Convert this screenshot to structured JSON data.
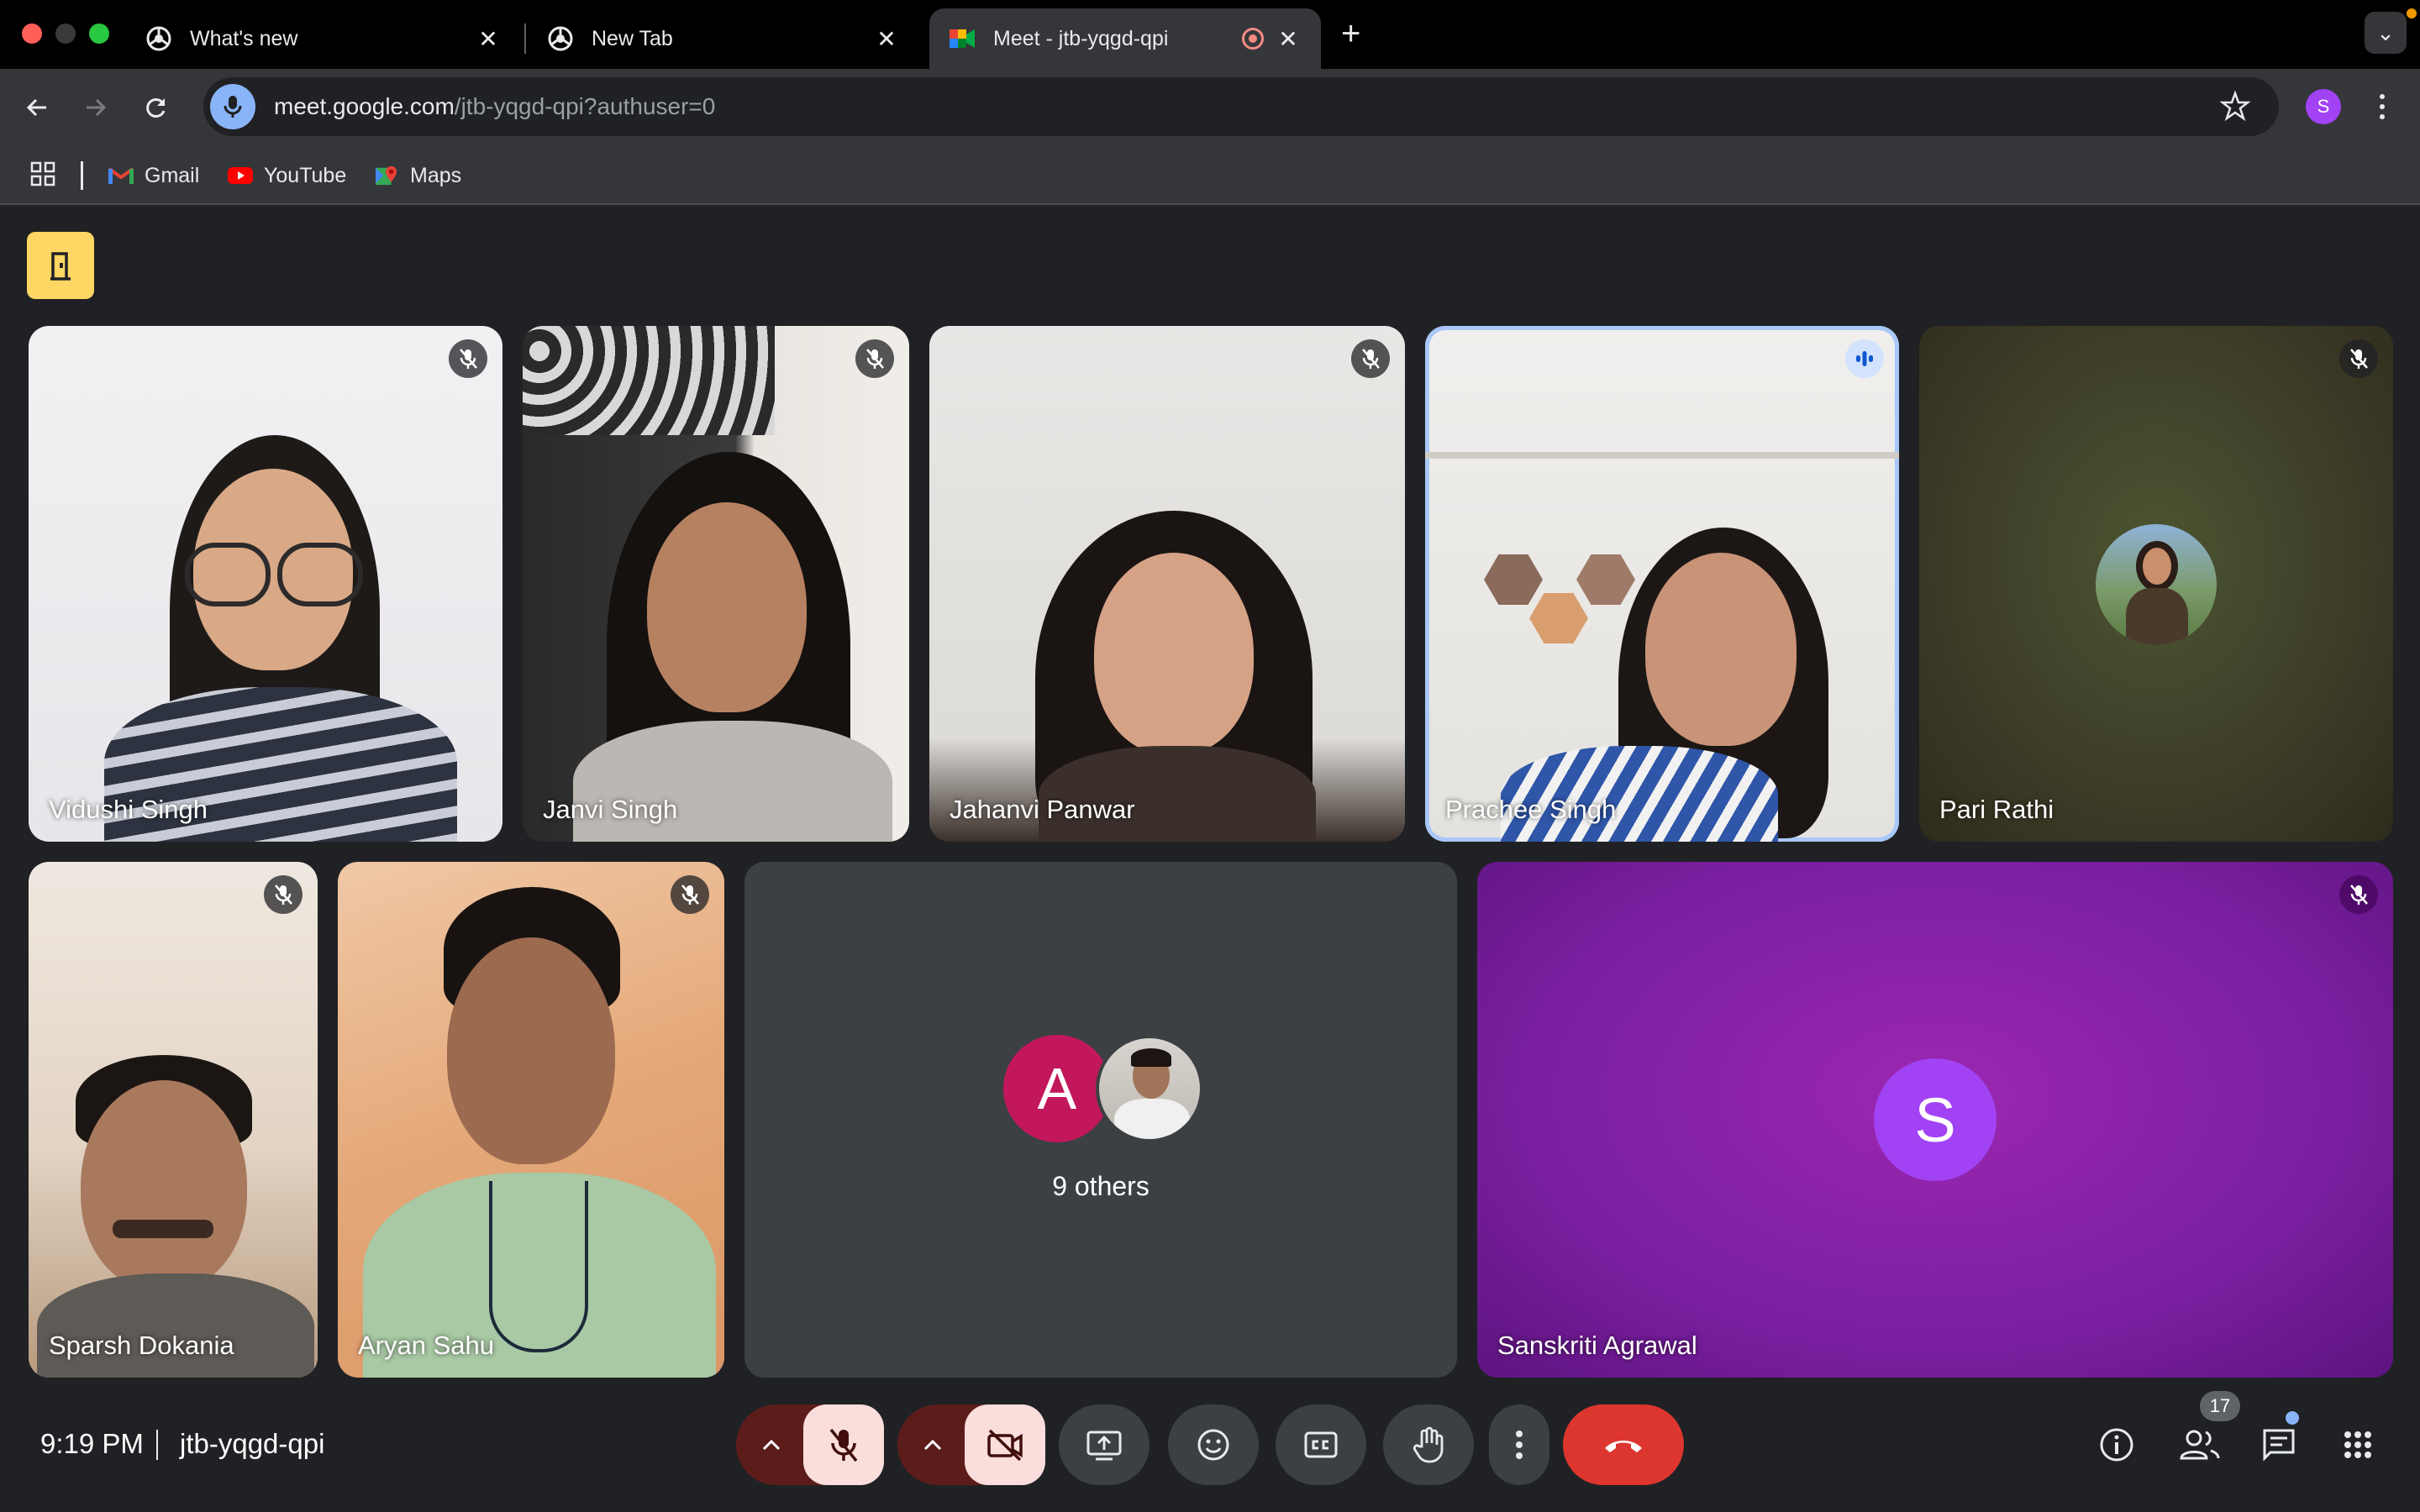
{
  "browser": {
    "tabs": [
      {
        "title": "What's new",
        "icon": "chrome-icon",
        "active": false
      },
      {
        "title": "New Tab",
        "icon": "chrome-icon",
        "active": false
      },
      {
        "title": "Meet - jtb-yqgd-qpi",
        "icon": "google-meet-icon",
        "active": true,
        "recording": true
      }
    ],
    "url_host": "meet.google.com",
    "url_path": "/jtb-yqgd-qpi?authuser=0",
    "profile_initial": "S",
    "bookmarks": [
      {
        "label": "Gmail",
        "icon": "gmail-icon"
      },
      {
        "label": "YouTube",
        "icon": "youtube-icon"
      },
      {
        "label": "Maps",
        "icon": "maps-icon"
      }
    ]
  },
  "meet": {
    "participants": [
      {
        "name": "Vidushi Singh",
        "muted": true
      },
      {
        "name": "Janvi Singh",
        "muted": true
      },
      {
        "name": "Jahanvi Panwar",
        "muted": true
      },
      {
        "name": "Prachee Singh",
        "muted": false,
        "speaking": true
      },
      {
        "name": "Pari Rathi",
        "muted": true
      },
      {
        "name": "Sparsh Dokania",
        "muted": true
      },
      {
        "name": "Aryan Sahu",
        "muted": true
      },
      {
        "name": "Sanskriti Agrawal",
        "muted": true,
        "avatar_initial": "S"
      }
    ],
    "others": {
      "label": "9 others",
      "avatar_initial": "A"
    },
    "time": "9:19 PM",
    "meeting_code": "jtb-yqgd-qpi",
    "participant_count": "17",
    "colors": {
      "accent_blue": "#8ab4f8",
      "end_call_red": "#ea4335",
      "muted_red_bg": "#f9dedc",
      "badge_yellow": "#fdd663",
      "sanskriti_purple": "#8b1fa6"
    }
  }
}
